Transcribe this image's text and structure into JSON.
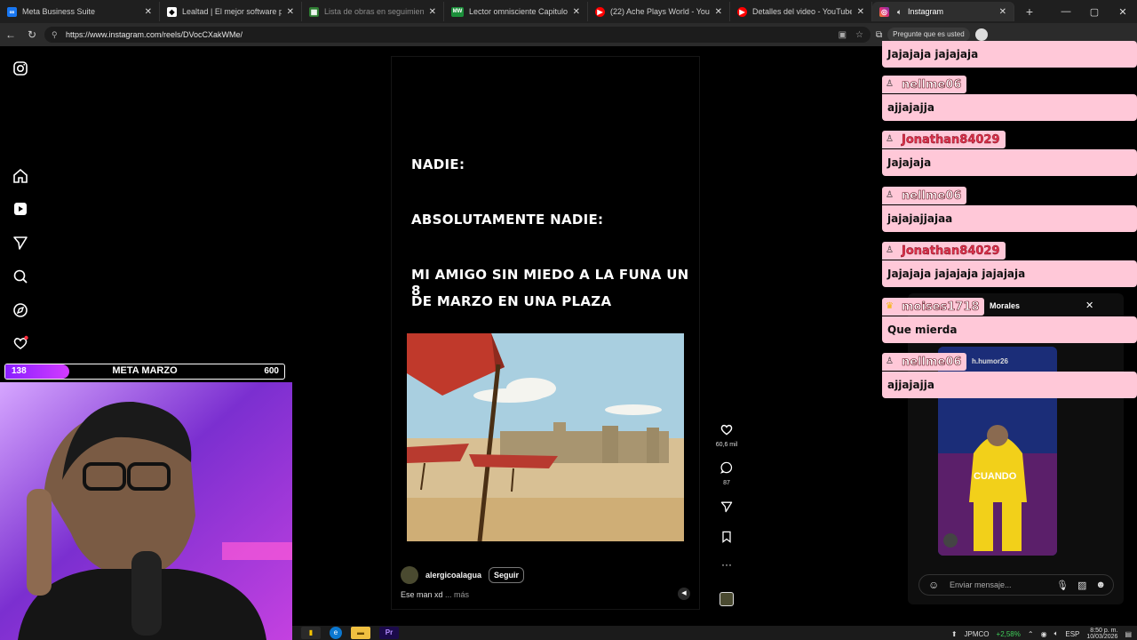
{
  "browser": {
    "tabs": [
      {
        "title": "Meta Business Suite",
        "favicon": "meta-icon",
        "color": "#1877f2",
        "active": false
      },
      {
        "title": "Lealtad | El mejor software para p",
        "favicon": "diamond-icon",
        "color": "#ffffff",
        "active": false
      },
      {
        "title": "Lista de obras en seguimiento - H",
        "favicon": "sheet-icon",
        "color": "#2e7d32",
        "active": false
      },
      {
        "title": "Lector omnisciente Capitulo 79 m",
        "favicon": "mw-icon",
        "color": "#1b8f3a",
        "active": false
      },
      {
        "title": "(22) Ache Plays World - YouTube",
        "favicon": "youtube-icon",
        "color": "#ff0000",
        "active": false
      },
      {
        "title": "Detalles del video - YouTube Studi",
        "favicon": "youtube-studio-icon",
        "color": "#ff0000",
        "active": false
      },
      {
        "title": "Instagram",
        "favicon": "instagram-icon",
        "color": "#e1306c",
        "active": true
      }
    ],
    "url": "https://www.instagram.com/reels/DVocCXakWMe/",
    "extension_pill": "Pregunte que es usted"
  },
  "reel": {
    "lines": [
      "NADIE:",
      "ABSOLUTAMENTE NADIE:",
      "MI AMIGO SIN MIEDO A LA FUNA UN 8",
      "DE MARZO EN UNA PLAZA"
    ],
    "author": "alergicoalagua",
    "follow_label": "Seguir",
    "caption": "Ese man xd",
    "caption_more": "... más",
    "likes": "60,6 mil",
    "comments": "87"
  },
  "overlay": {
    "goal_title": "META MARZO",
    "goal_current": "138",
    "goal_target": "600",
    "goal_progress": 0.23
  },
  "chat": [
    {
      "user": "",
      "message": "Jajajaja jajajaja",
      "alt": false
    },
    {
      "user": "nellme06",
      "message": "ajjajajja",
      "alt": false
    },
    {
      "user": "Jonathan84029",
      "message": "Jajajaja",
      "alt": true
    },
    {
      "user": "nellme06",
      "message": "jajajajjajaa",
      "alt": false
    },
    {
      "user": "Jonathan84029",
      "message": "Jajajaja jajajaja jajajaja",
      "alt": true
    },
    {
      "user": "moises1718",
      "message": "Que mierda",
      "alt": false
    },
    {
      "user": "nellme06",
      "message": "ajjajajja",
      "alt": false
    }
  ],
  "dm": {
    "header": "Morales",
    "handle": "h.humor26",
    "thumb_caption": "CUANDO",
    "message_placeholder": "Enviar mensaje..."
  },
  "taskbar": {
    "ticker": "JPMCO",
    "ticker_change": "+2,58%",
    "language": "ESP",
    "time": "8:50 p. m.",
    "date": "10/03/2026"
  }
}
